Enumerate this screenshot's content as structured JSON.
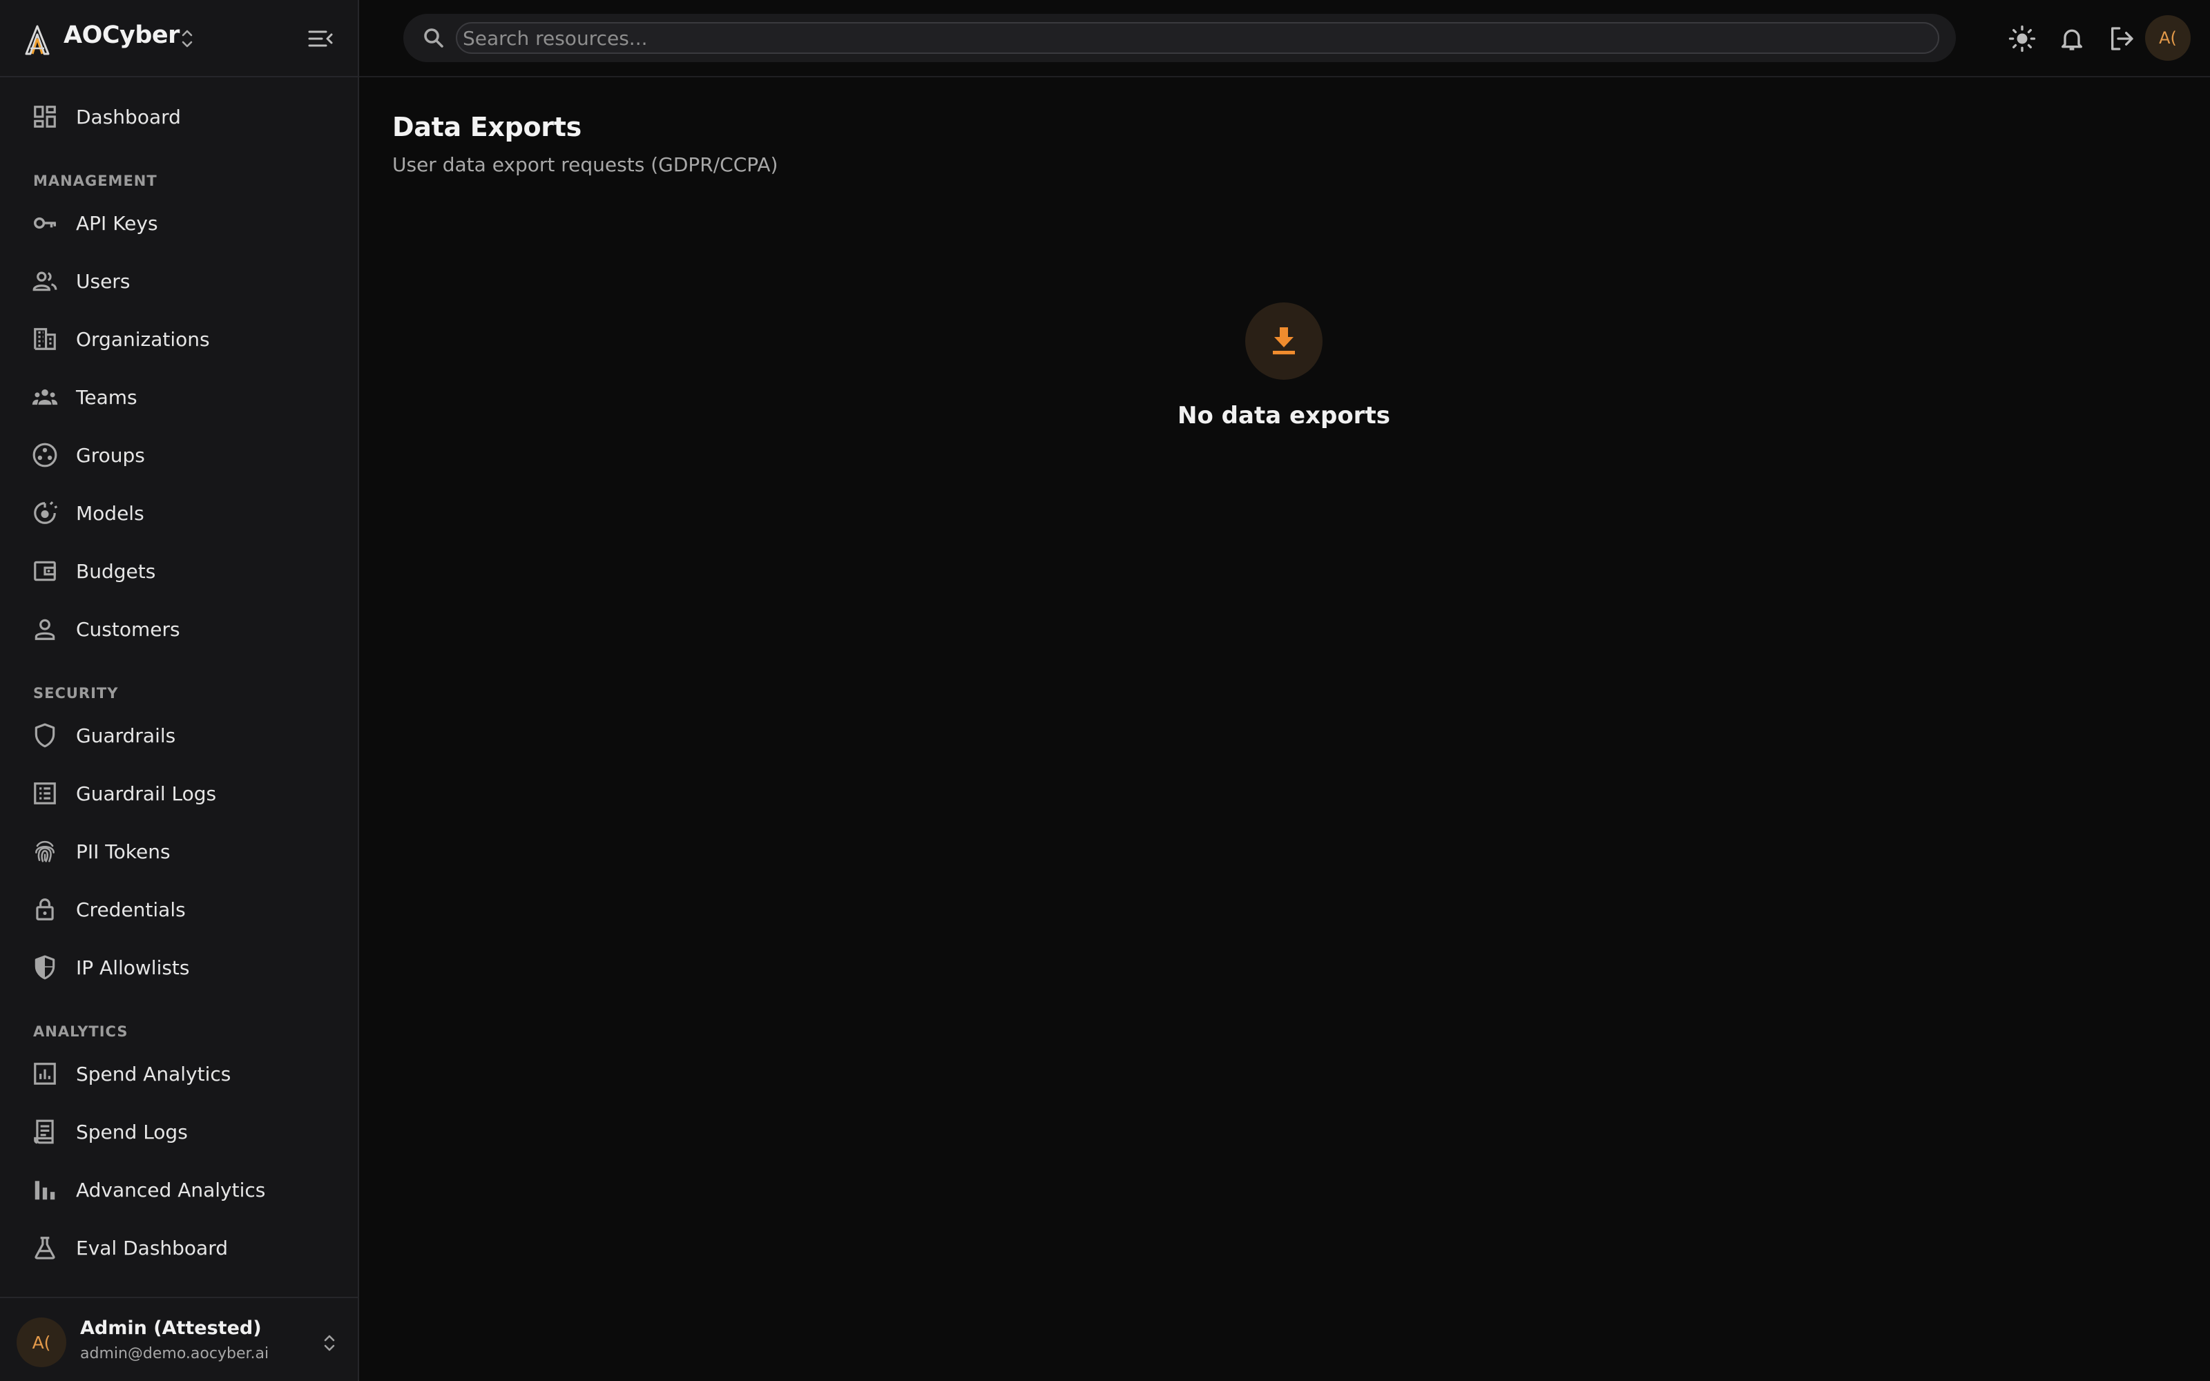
{
  "app": {
    "name": "AOCyber",
    "accent_color": "#f08c2e"
  },
  "sidebar": {
    "dashboard": {
      "label": "Dashboard",
      "icon": "dashboard-icon"
    },
    "sections": [
      {
        "title": "MANAGEMENT",
        "items": [
          {
            "label": "API Keys",
            "icon": "key-icon"
          },
          {
            "label": "Users",
            "icon": "users-icon"
          },
          {
            "label": "Organizations",
            "icon": "building-icon"
          },
          {
            "label": "Teams",
            "icon": "team-icon"
          },
          {
            "label": "Groups",
            "icon": "groups-icon"
          },
          {
            "label": "Models",
            "icon": "model-icon"
          },
          {
            "label": "Budgets",
            "icon": "wallet-icon"
          },
          {
            "label": "Customers",
            "icon": "person-icon"
          }
        ]
      },
      {
        "title": "SECURITY",
        "items": [
          {
            "label": "Guardrails",
            "icon": "shield-icon"
          },
          {
            "label": "Guardrail Logs",
            "icon": "log-list-icon"
          },
          {
            "label": "PII Tokens",
            "icon": "fingerprint-icon"
          },
          {
            "label": "Credentials",
            "icon": "lock-icon"
          },
          {
            "label": "IP Allowlists",
            "icon": "shield-half-icon"
          }
        ]
      },
      {
        "title": "ANALYTICS",
        "items": [
          {
            "label": "Spend Analytics",
            "icon": "analytics-icon"
          },
          {
            "label": "Spend Logs",
            "icon": "receipt-icon"
          },
          {
            "label": "Advanced Analytics",
            "icon": "bar-chart-icon"
          },
          {
            "label": "Eval Dashboard",
            "icon": "flask-icon"
          }
        ]
      }
    ]
  },
  "user": {
    "initials": "A(",
    "name": "Admin (Attested)",
    "email": "admin@demo.aocyber.ai"
  },
  "topbar": {
    "search_placeholder": "Search resources...",
    "icons": [
      "theme-toggle-icon",
      "bell-icon",
      "logout-icon"
    ]
  },
  "page": {
    "title": "Data Exports",
    "subtitle": "User data export requests (GDPR/CCPA)",
    "empty_state": {
      "icon": "download-icon",
      "title": "No data exports"
    }
  }
}
